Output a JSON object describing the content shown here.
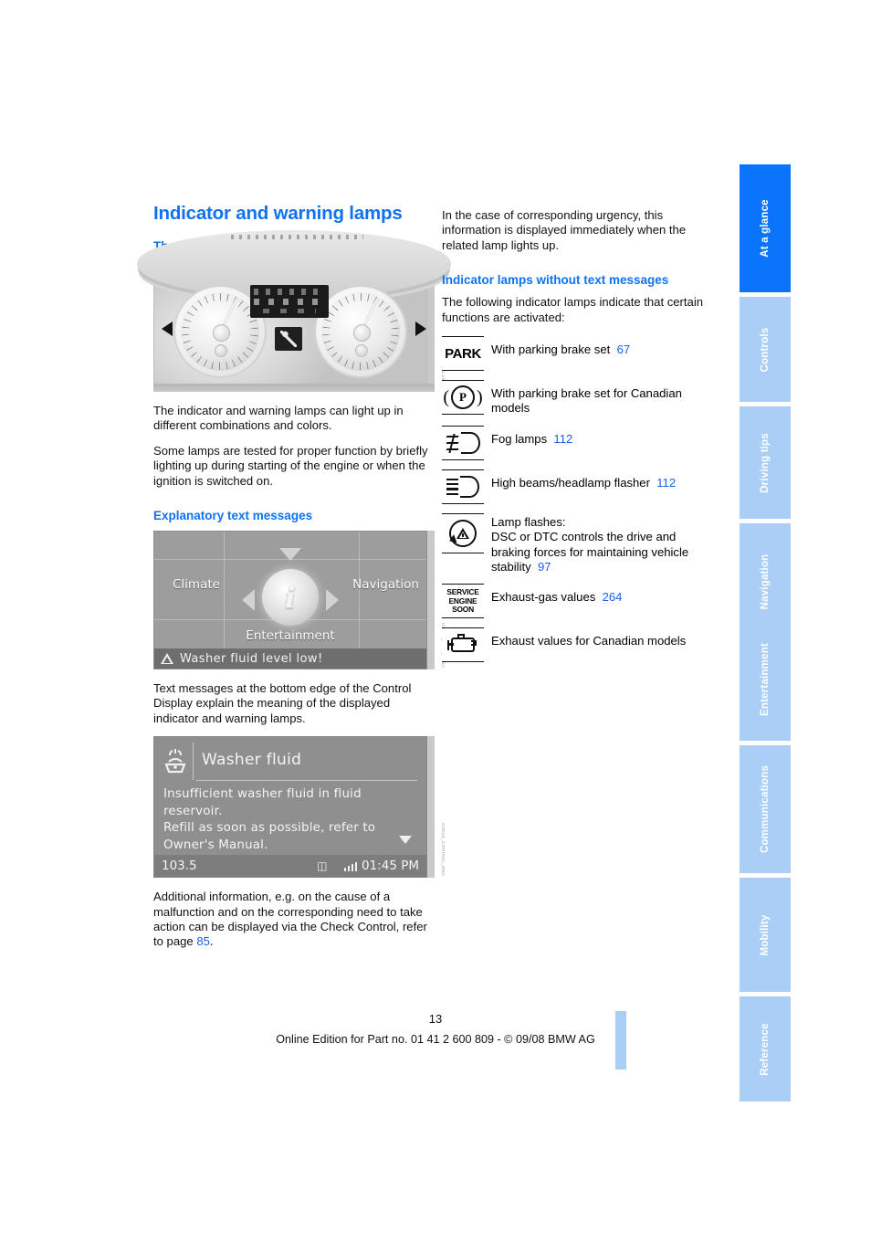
{
  "sidebar": {
    "tabs": [
      {
        "label": "At a glance",
        "active": true
      },
      {
        "label": "Controls",
        "active": false
      },
      {
        "label": "Driving tips",
        "active": false
      },
      {
        "label": "Navigation",
        "active": false
      },
      {
        "label": "Entertainment",
        "active": false
      },
      {
        "label": "Communications",
        "active": false
      },
      {
        "label": "Mobility",
        "active": false
      },
      {
        "label": "Reference",
        "active": false
      }
    ],
    "active_color": "#0b74fd",
    "inactive_color": "#aacef5"
  },
  "left_column": {
    "title": "Indicator and warning lamps",
    "section_concept_heading": "The concept",
    "paragraph_1": "The indicator and warning lamps can light up in different combinations and colors.",
    "paragraph_2": "Some lamps are tested for proper function by briefly lighting up during starting of the engine or when the ignition is switched on.",
    "section_explanatory_heading": "Explanatory text messages",
    "paragraph_3": "Text messages at the bottom edge of the Control Display explain the meaning of the displayed indicator and warning lamps.",
    "paragraph_4_a": "Additional information, e.g. on the cause of a malfunction and on the corresponding need to take action can be displayed via the Check Control, refer to page ",
    "paragraph_4_ref": "85",
    "paragraph_4_b": "."
  },
  "figures": {
    "cluster": {
      "caption_code": "BMW_INSTR_CLUSTER"
    },
    "idrive": {
      "menu_climate": "Climate",
      "menu_navigation": "Navigation",
      "menu_entertainment": "Entertainment",
      "center_icon": "info-i",
      "status_message": "Washer fluid level low!",
      "caption_code": "IDRIVE_MAIN_MENU"
    },
    "message": {
      "title": "Washer fluid",
      "icon": "washer-fluid-icon",
      "body": "Insufficient washer fluid in fluid reservoir.\nRefill as soon as possible, refer to Owner's Manual.",
      "status_frequency": "103.5",
      "status_time": "01:45 PM",
      "caption_code": "CHECK_CONTROL_MSG"
    }
  },
  "right_column": {
    "paragraph_1": "In the case of corresponding urgency, this information is displayed immediately when the related lamp lights up.",
    "section_heading": "Indicator lamps without text messages",
    "paragraph_2": "The following indicator lamps indicate that certain functions are activated:",
    "lamps": [
      {
        "icon": "park-brake-text-icon",
        "icon_text": "PARK",
        "text": "With parking brake set",
        "page_ref": "67"
      },
      {
        "icon": "park-brake-canada-icon",
        "icon_text": "P",
        "text": "With parking brake set for Canadian models",
        "page_ref": ""
      },
      {
        "icon": "fog-lamp-icon",
        "icon_text": "",
        "text": "Fog lamps",
        "page_ref": "112"
      },
      {
        "icon": "high-beam-icon",
        "icon_text": "",
        "text": "High beams/headlamp flasher",
        "page_ref": "112"
      },
      {
        "icon": "dsc-dtc-icon",
        "icon_text": "",
        "text": "Lamp flashes:\nDSC or DTC controls the drive and braking forces for maintaining vehicle stability",
        "page_ref": "97"
      },
      {
        "icon": "service-engine-soon-icon",
        "icon_text": "SERVICE ENGINE SOON",
        "text": "Exhaust-gas values",
        "page_ref": "264"
      },
      {
        "icon": "check-engine-icon",
        "icon_text": "",
        "text": "Exhaust values for Canadian models",
        "page_ref": ""
      }
    ]
  },
  "footer": {
    "page_number": "13",
    "imprint": "Online Edition for Part no. 01 41 2 600 809 - © 09/08 BMW AG"
  },
  "colors": {
    "heading_blue": "#1072f0",
    "link_blue": "#1a5ff0",
    "tab_active": "#0b74fd",
    "tab_inactive": "#aacef5"
  }
}
